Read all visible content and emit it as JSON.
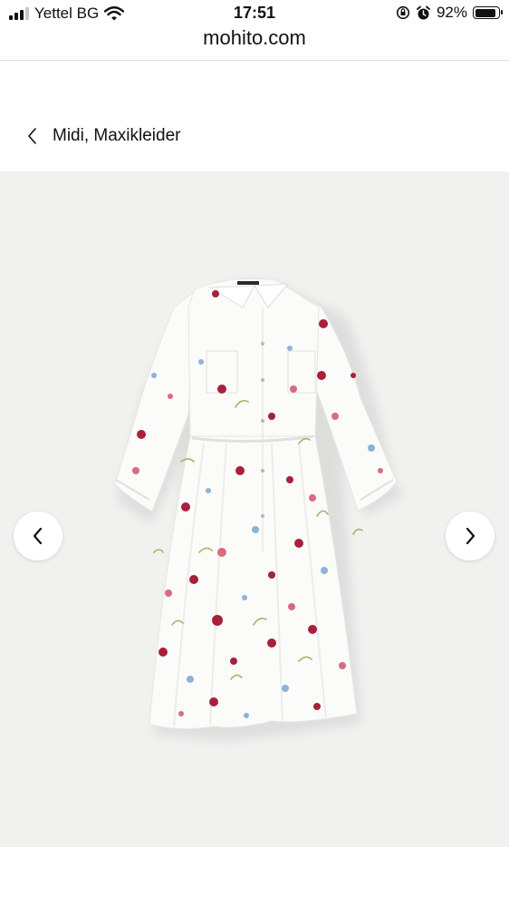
{
  "status_bar": {
    "carrier": "Yettel BG",
    "time": "17:51",
    "battery_percent": "92%",
    "battery_level": 0.92
  },
  "browser": {
    "url": "mohito.com"
  },
  "breadcrumb": {
    "back_label": "Midi, Maxikleider"
  },
  "colors": {
    "gallery_bg": "#f1f1f0",
    "dress": "#fbfbfa",
    "flower_red": "#a8203a",
    "flower_pink": "#d86b82",
    "flower_blue": "#8fb2d6",
    "leaf": "#b4ad6a"
  },
  "icons": {
    "back": "chevron-left-icon",
    "prev": "chevron-left-icon",
    "next": "chevron-right-icon",
    "wifi": "wifi-icon",
    "alarm": "alarm-icon",
    "lock": "rotation-lock-icon"
  }
}
